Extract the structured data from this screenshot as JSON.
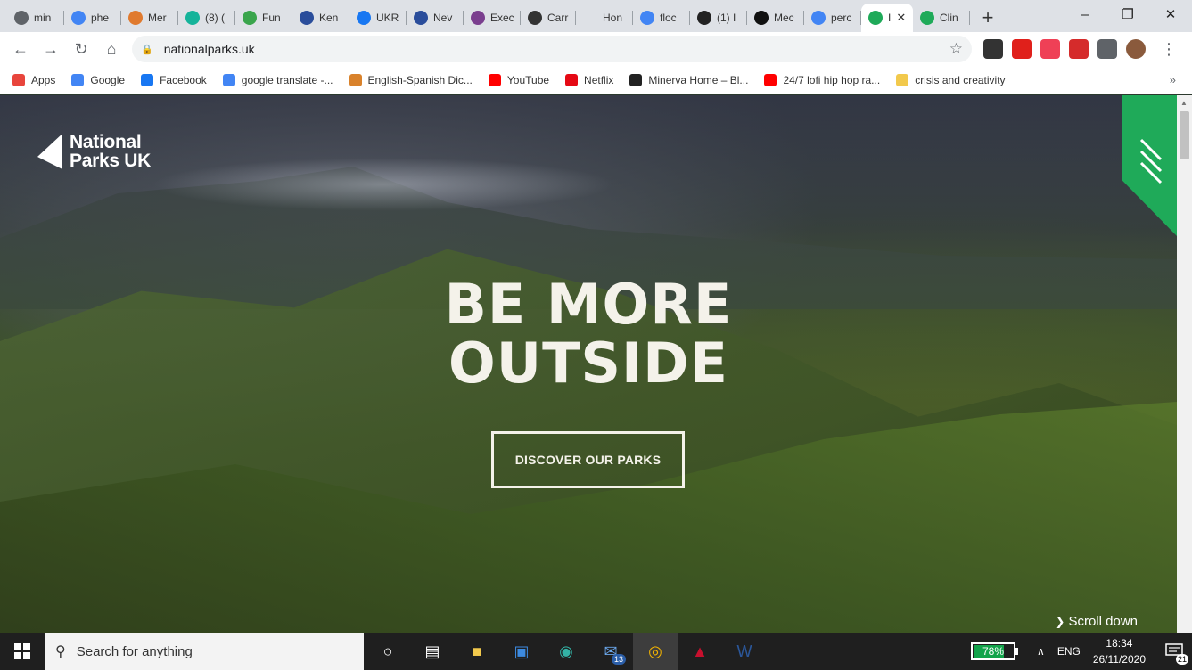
{
  "browser": {
    "tabs": [
      {
        "label": "min",
        "icon": "globe-icon",
        "color": "#5f6368"
      },
      {
        "label": "phe",
        "icon": "google-icon",
        "color": "#4285f4"
      },
      {
        "label": "Mer",
        "icon": "etymology-icon",
        "color": "#e07a2e"
      },
      {
        "label": "(8) (",
        "icon": "researchgate-icon",
        "color": "#15b39a"
      },
      {
        "label": "Fun",
        "icon": "bookmark-site-icon",
        "color": "#3aa54c"
      },
      {
        "label": "Ken",
        "icon": "kenhub-icon",
        "color": "#2a4d9b"
      },
      {
        "label": "UKR",
        "icon": "facebook-icon",
        "color": "#1877f2"
      },
      {
        "label": "Nev",
        "icon": "kenhub-icon",
        "color": "#2a4d9b"
      },
      {
        "label": "Exec",
        "icon": "circle-logo-icon",
        "color": "#7a3e8e"
      },
      {
        "label": "Carr",
        "icon": "xpe-icon",
        "color": "#333333"
      },
      {
        "label": "Hon",
        "icon": "blank-icon",
        "color": "#dee1e6"
      },
      {
        "label": "floc",
        "icon": "google-icon",
        "color": "#4285f4"
      },
      {
        "label": "(1) I",
        "icon": "ac-icon",
        "color": "#222222"
      },
      {
        "label": "Mec",
        "icon": "v-icon",
        "color": "#111111"
      },
      {
        "label": "perc",
        "icon": "google-icon",
        "color": "#4285f4"
      },
      {
        "label": "I",
        "icon": "national-parks-icon",
        "color": "#1faa59",
        "active": true
      },
      {
        "label": "Clin",
        "icon": "national-parks-icon",
        "color": "#1faa59"
      }
    ],
    "url": "nationalparks.uk",
    "bookmarks": [
      {
        "label": "Apps",
        "icon": "apps-grid-icon",
        "color": "#e8453c"
      },
      {
        "label": "Google",
        "icon": "google-icon",
        "color": "#4285f4"
      },
      {
        "label": "Facebook",
        "icon": "facebook-icon",
        "color": "#1877f2"
      },
      {
        "label": "google translate -...",
        "icon": "google-icon",
        "color": "#4285f4"
      },
      {
        "label": "English-Spanish Dic...",
        "icon": "wordreference-icon",
        "color": "#d9822b"
      },
      {
        "label": "YouTube",
        "icon": "youtube-icon",
        "color": "#ff0000"
      },
      {
        "label": "Netflix",
        "icon": "netflix-icon",
        "color": "#e50914"
      },
      {
        "label": "Minerva Home – Bl...",
        "icon": "minerva-icon",
        "color": "#222222"
      },
      {
        "label": "24/7 lofi hip hop ra...",
        "icon": "youtube-icon",
        "color": "#ff0000"
      },
      {
        "label": "crisis and creativity",
        "icon": "folder-icon",
        "color": "#f2c94c"
      }
    ],
    "extensions": [
      {
        "icon": "dark-reader-icon",
        "color": "#333333"
      },
      {
        "icon": "opera-icon",
        "color": "#e0201b"
      },
      {
        "icon": "pocket-icon",
        "color": "#ef4056"
      },
      {
        "icon": "mendeley-icon",
        "color": "#d52b2b"
      },
      {
        "icon": "puzzle-icon",
        "color": "#5f6368"
      },
      {
        "icon": "profile-avatar-icon",
        "color": "#8a5a3c"
      }
    ]
  },
  "page": {
    "logo_line1": "National",
    "logo_line2": "Parks UK",
    "headline_line1": "BE MORE",
    "headline_line2": "OUTSIDE",
    "cta_label": "DISCOVER OUR PARKS",
    "scroll_label": "Scroll down",
    "accent_color": "#1faa59"
  },
  "taskbar": {
    "search_placeholder": "Search for anything",
    "pinned": [
      {
        "icon": "cortana-icon"
      },
      {
        "icon": "task-view-icon"
      },
      {
        "icon": "file-explorer-icon"
      },
      {
        "icon": "microsoft-store-icon"
      },
      {
        "icon": "edge-icon"
      },
      {
        "icon": "mail-icon",
        "badge": "13"
      },
      {
        "icon": "chrome-icon",
        "active": true
      },
      {
        "icon": "mcafee-icon"
      },
      {
        "icon": "word-icon"
      }
    ],
    "battery_percent": "78%",
    "battery_level": 0.78,
    "language": "ENG",
    "time": "18:34",
    "date": "26/11/2020",
    "notifications": "21"
  }
}
